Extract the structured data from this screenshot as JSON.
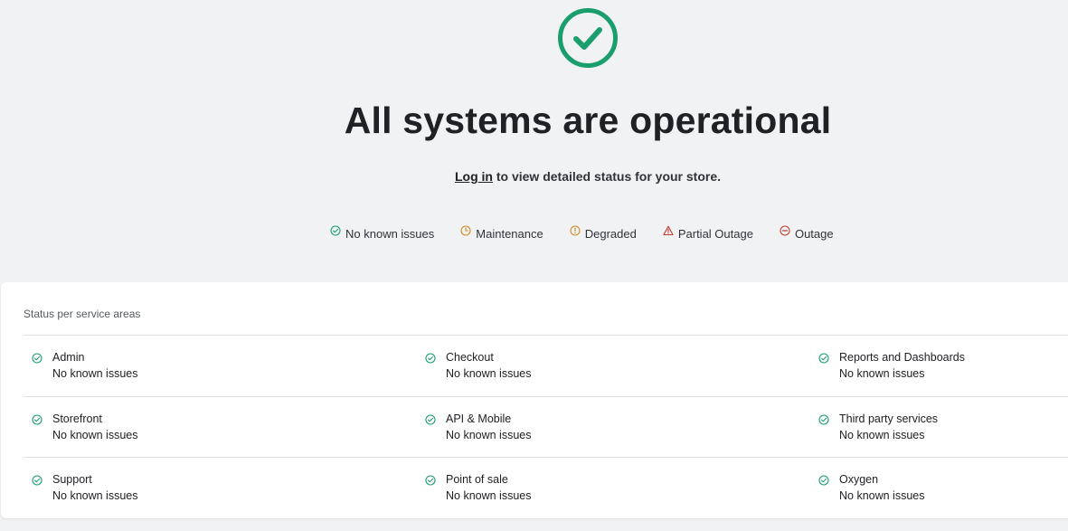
{
  "hero": {
    "icon": "check-circle-icon",
    "headline": "All systems are operational",
    "login_link": "Log in",
    "login_suffix": " to view detailed status for your store."
  },
  "legend": [
    {
      "label": "No known issues",
      "icon": "check-circle-icon",
      "color": "#1a9e6e"
    },
    {
      "label": "Maintenance",
      "icon": "clock-icon",
      "color": "#d08a1f"
    },
    {
      "label": "Degraded",
      "icon": "info-circle-icon",
      "color": "#d08a1f"
    },
    {
      "label": "Partial Outage",
      "icon": "warning-triangle-icon",
      "color": "#c0392b"
    },
    {
      "label": "Outage",
      "icon": "minus-circle-icon",
      "color": "#c0392b"
    }
  ],
  "services": {
    "title": "Status per service areas",
    "rows": [
      [
        {
          "name": "Admin",
          "status": "No known issues"
        },
        {
          "name": "Checkout",
          "status": "No known issues"
        },
        {
          "name": "Reports and Dashboards",
          "status": "No known issues"
        }
      ],
      [
        {
          "name": "Storefront",
          "status": "No known issues"
        },
        {
          "name": "API & Mobile",
          "status": "No known issues"
        },
        {
          "name": "Third party services",
          "status": "No known issues"
        }
      ],
      [
        {
          "name": "Support",
          "status": "No known issues"
        },
        {
          "name": "Point of sale",
          "status": "No known issues"
        },
        {
          "name": "Oxygen",
          "status": "No known issues"
        }
      ]
    ]
  },
  "colors": {
    "operational": "#1a9e6e",
    "background": "#f1f2f4",
    "panel": "#ffffff"
  }
}
